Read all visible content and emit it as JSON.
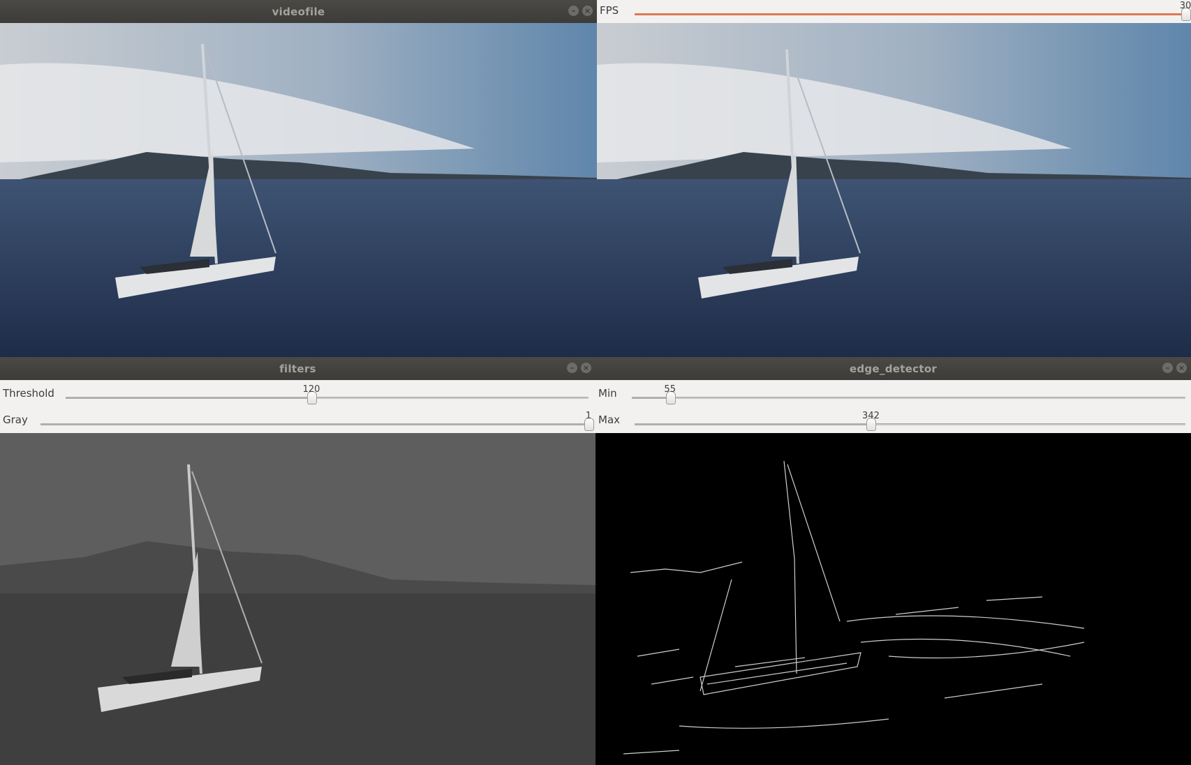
{
  "windows": {
    "videofile": {
      "title": "videofile"
    },
    "right_top": {
      "fps": {
        "label": "FPS",
        "value": "30",
        "fraction": 1.0
      }
    },
    "filters": {
      "title": "filters",
      "threshold": {
        "label": "Threshold",
        "value": "120",
        "fraction": 0.47
      },
      "gray": {
        "label": "Gray",
        "value": "1",
        "fraction": 1.0
      }
    },
    "edge_detector": {
      "title": "edge_detector",
      "min": {
        "label": "Min",
        "value": "55",
        "fraction": 0.069
      },
      "max": {
        "label": "Max",
        "value": "342",
        "fraction": 0.429
      }
    }
  },
  "icons": {
    "minimize": "minimize-icon",
    "close": "close-icon"
  },
  "colors": {
    "titlebar": "#3d3c39",
    "slider_fill": "#e0794f",
    "panel": "#f2f1f0"
  }
}
